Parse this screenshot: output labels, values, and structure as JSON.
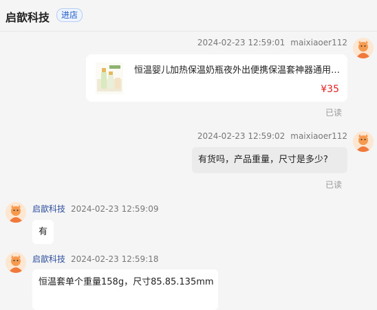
{
  "header": {
    "shop_name": "启歆科技",
    "store_button": "进店"
  },
  "messages": [
    {
      "type": "product",
      "timestamp": "2024-02-23 12:59:01",
      "username": "maixiaoer112",
      "product_title": "恒温婴儿加热保温奶瓶夜外出便携保温套神器通用套便...",
      "price": "¥35",
      "status": "已读"
    },
    {
      "type": "text",
      "timestamp": "2024-02-23 12:59:02",
      "username": "maixiaoer112",
      "text": "有货吗，产品重量，尺寸是多少?",
      "status": "已读"
    },
    {
      "type": "text",
      "sender": "启歆科技",
      "timestamp": "2024-02-23 12:59:09",
      "text": "有"
    },
    {
      "type": "text",
      "sender": "启歆科技",
      "timestamp": "2024-02-23 12:59:18",
      "text": "恒温套单个重量158g，尺寸85.85.135mm"
    }
  ],
  "colors": {
    "price": "#e02020",
    "sender_name": "#2e4f9e",
    "store_button": "#1e5bc6"
  }
}
